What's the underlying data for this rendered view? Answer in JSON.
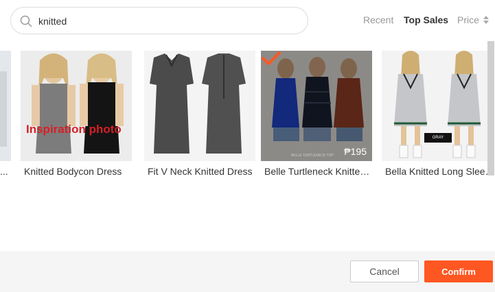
{
  "search": {
    "value": "knitted",
    "placeholder": ""
  },
  "sort": {
    "recent": "Recent",
    "top_sales": "Top Sales",
    "price": "Price"
  },
  "products": [
    {
      "name": "...",
      "partial": true
    },
    {
      "name": "Knitted Bodycon Dress",
      "overlay_text": "Inspiration photo"
    },
    {
      "name": "Fit V Neck Knitted Dress"
    },
    {
      "name": "Belle Turtleneck Knitted Top",
      "price": "₱195",
      "selected": true,
      "caption": "BELLE TURTLENECK TOP"
    },
    {
      "name": "Bella Knitted Long Sleeve Dress",
      "tag": "GRAY"
    }
  ],
  "footer": {
    "cancel_label": "Cancel",
    "confirm_label": "Confirm"
  },
  "colors": {
    "accent": "#ff5722",
    "text": "#333333",
    "muted": "#999999"
  },
  "icons": {
    "search": "search-icon",
    "sort": "sort-arrows-icon",
    "check": "check-icon"
  }
}
